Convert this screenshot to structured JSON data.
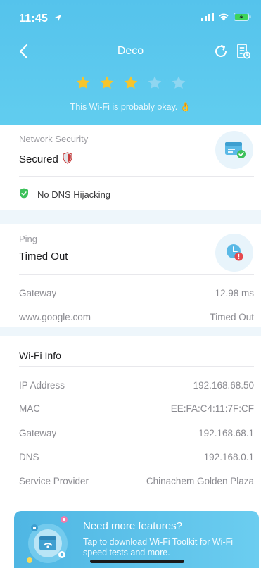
{
  "status_bar": {
    "time": "11:45"
  },
  "nav": {
    "title": "Deco"
  },
  "rating": {
    "stars_filled": 3,
    "stars_total": 5,
    "text": "This Wi-Fi is probably okay. 👌"
  },
  "security": {
    "label": "Network Security",
    "value": "Secured",
    "dns_item": "No DNS Hijacking"
  },
  "ping": {
    "label": "Ping",
    "value": "Timed Out",
    "rows": [
      {
        "name": "Gateway",
        "value": "12.98 ms"
      },
      {
        "name": "www.google.com",
        "value": "Timed Out"
      }
    ]
  },
  "wifi_info": {
    "title": "Wi-Fi Info",
    "rows": [
      {
        "name": "IP Address",
        "value": "192.168.68.50"
      },
      {
        "name": "MAC",
        "value": "EE:FA:C4:11:7F:CF"
      },
      {
        "name": "Gateway",
        "value": "192.168.68.1"
      },
      {
        "name": "DNS",
        "value": "192.168.0.1"
      },
      {
        "name": "Service Provider",
        "value": "Chinachem Golden Plaza"
      }
    ]
  },
  "banner": {
    "title": "Need more features?",
    "text": "Tap to download Wi-Fi Toolkit for Wi-Fi speed tests and more."
  },
  "colors": {
    "header": "#5ac8ee",
    "star_filled": "#f7c52b",
    "star_empty": "#8fd6f1",
    "green": "#3cc15a",
    "red": "#e5484d"
  }
}
